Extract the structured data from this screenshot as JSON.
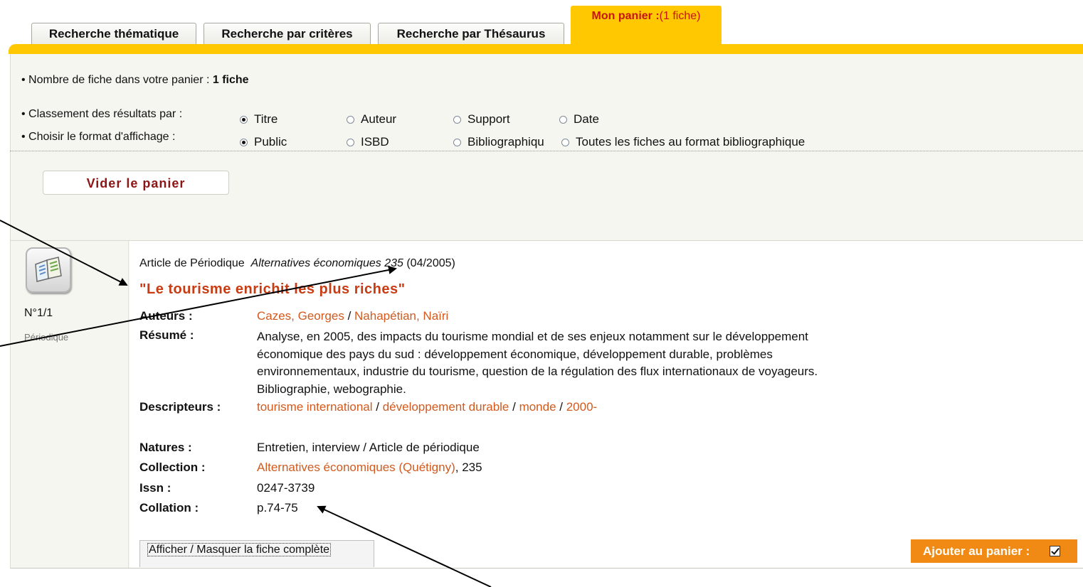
{
  "tabs": [
    {
      "label": "Recherche thématique"
    },
    {
      "label": "Recherche par critères"
    },
    {
      "label": "Recherche par Thésaurus"
    }
  ],
  "active_tab": {
    "label": "Mon panier :",
    "count": "(1 fiche)"
  },
  "panier": {
    "count_label": "• Nombre de fiche dans votre panier :",
    "count_value": "1 fiche"
  },
  "sort": {
    "label": "• Classement des résultats par :",
    "options": [
      "Titre",
      "Auteur",
      "Support",
      "Date"
    ],
    "selected": "Titre"
  },
  "format": {
    "label": "• Choisir le format d'affichage :",
    "options": [
      "Public",
      "ISBD",
      "Bibliographiqu",
      "Toutes les fiches au format bibliographique"
    ],
    "selected": "Public"
  },
  "buttons": {
    "vider": "Vider le panier",
    "toggle": "Afficher / Masquer la fiche complète",
    "add": "Ajouter au panier :"
  },
  "result": {
    "icon": "periodical-book-icon",
    "number": "N°1/1",
    "support": "Périodique",
    "type": "Article de Périodique",
    "source": "Alternatives économiques 235",
    "date": "(04/2005)",
    "title": "\"Le tourisme enrichit les plus riches\"",
    "fields": {
      "auteurs_label": "Auteurs :",
      "auteurs": [
        "Cazes, Georges",
        "Nahapétian, Naïri"
      ],
      "resume_label": "Résumé :",
      "resume": "Analyse, en 2005, des impacts du tourisme mondial et de ses enjeux notamment sur le développement économique des pays du sud : développement économique, développement durable, problèmes environnementaux, industrie du tourisme, question de la régulation des flux internationaux de voyageurs. Bibliographie, webographie.",
      "descripteurs_label": "Descripteurs :",
      "descripteurs": [
        "tourisme international",
        "développement durable",
        "monde",
        "2000-"
      ],
      "natures_label": "Natures :",
      "natures": "Entretien, interview / Article de périodique",
      "collection_label": "Collection :",
      "collection": "Alternatives économiques (Quétigny)",
      "collection_num": ", 235",
      "issn_label": "Issn :",
      "issn": "0247-3739",
      "collation_label": "Collation :",
      "collation": "p.74-75"
    },
    "in_basket": true
  },
  "colors": {
    "accent": "#ffc800",
    "link": "#d25a1e",
    "title": "#c83c14",
    "add_button": "#f08a14"
  }
}
